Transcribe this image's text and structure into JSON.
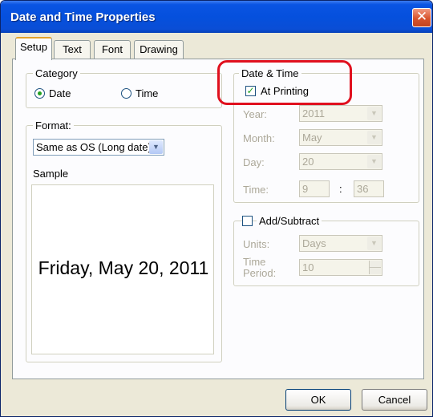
{
  "window": {
    "title": "Date and Time Properties",
    "close_glyph": "✕"
  },
  "tabs": [
    {
      "label": "Setup",
      "active": true
    },
    {
      "label": "Text",
      "active": false
    },
    {
      "label": "Font",
      "active": false
    },
    {
      "label": "Drawing",
      "active": false
    }
  ],
  "category": {
    "legend": "Category",
    "options": [
      {
        "label": "Date",
        "selected": true
      },
      {
        "label": "Time",
        "selected": false
      }
    ]
  },
  "format": {
    "legend": "Format:",
    "value": "Same as OS (Long date)",
    "sample_label": "Sample",
    "sample_text": "Friday, May 20, 2011"
  },
  "datetime": {
    "legend": "Date & Time",
    "at_printing_label": "At Printing",
    "at_printing_checked": true,
    "year_label": "Year:",
    "year_value": "2011",
    "month_label": "Month:",
    "month_value": "May",
    "day_label": "Day:",
    "day_value": "20",
    "time_label": "Time:",
    "hour_value": "9",
    "separator": ":",
    "minute_value": "36"
  },
  "add_subtract": {
    "legend": "Add/Subtract",
    "checked": false,
    "units_label": "Units:",
    "units_value": "Days",
    "period_label_line1": "Time",
    "period_label_line2": "Period:",
    "period_value": "10"
  },
  "buttons": {
    "ok": "OK",
    "cancel": "Cancel"
  },
  "icons": {
    "close": "close-icon",
    "dropdown": "chevron-down-icon",
    "check": "checkmark-icon"
  },
  "colors": {
    "titlebar": "#0550dd",
    "highlight": "#e0101e",
    "dialog_bg": "#ece9d8"
  }
}
